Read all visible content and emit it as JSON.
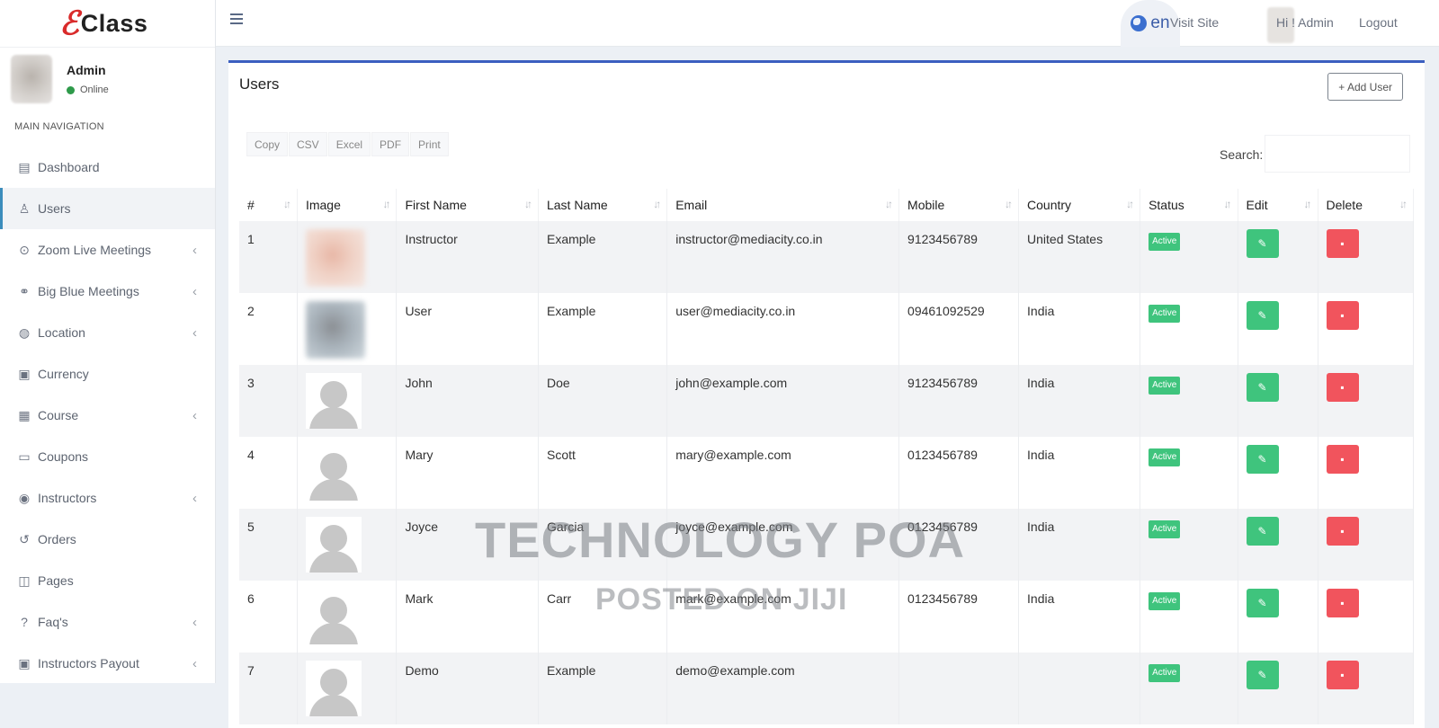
{
  "brand": {
    "mark": "ℰ",
    "name": "Class"
  },
  "user_panel": {
    "name": "Admin",
    "status": "Online"
  },
  "nav": {
    "header": "MAIN NAVIGATION",
    "items": [
      {
        "label": "Dashboard",
        "icon": "id-card-icon",
        "glyph": "▤",
        "chevron": false
      },
      {
        "label": "Users",
        "icon": "user-icon",
        "glyph": "♙",
        "chevron": false
      },
      {
        "label": "Zoom Live Meetings",
        "icon": "play-circle-icon",
        "glyph": "⊙",
        "chevron": true
      },
      {
        "label": "Big Blue Meetings",
        "icon": "handshake-icon",
        "glyph": "⚭",
        "chevron": true
      },
      {
        "label": "Location",
        "icon": "globe-icon",
        "glyph": "◍",
        "chevron": true
      },
      {
        "label": "Currency",
        "icon": "money-icon",
        "glyph": "▣",
        "chevron": false
      },
      {
        "label": "Course",
        "icon": "course-icon",
        "glyph": "▦",
        "chevron": true
      },
      {
        "label": "Coupons",
        "icon": "cc-icon",
        "glyph": "▭",
        "chevron": false
      },
      {
        "label": "Instructors",
        "icon": "user-circle-icon",
        "glyph": "◉",
        "chevron": true
      },
      {
        "label": "Orders",
        "icon": "history-icon",
        "glyph": "↺",
        "chevron": false
      },
      {
        "label": "Pages",
        "icon": "columns-icon",
        "glyph": "◫",
        "chevron": false
      },
      {
        "label": "Faq's",
        "icon": "question-circle-icon",
        "glyph": "?",
        "chevron": true
      },
      {
        "label": "Instructors Payout",
        "icon": "money-icon",
        "glyph": "▣",
        "chevron": true
      }
    ]
  },
  "topbar": {
    "lang": "en",
    "visit_site": "Visit Site",
    "greeting": "Hi ! Admin",
    "logout": "Logout"
  },
  "panel": {
    "title": "Users",
    "add_button": "+ Add User"
  },
  "exports": [
    "Copy",
    "CSV",
    "Excel",
    "PDF",
    "Print"
  ],
  "search": {
    "label": "Search:",
    "placeholder": ""
  },
  "table": {
    "columns": [
      "#",
      "Image",
      "First Name",
      "Last Name",
      "Email",
      "Mobile",
      "Country",
      "Status",
      "Edit",
      "Delete"
    ],
    "rows": [
      {
        "num": "1",
        "image": "photo-warm",
        "first": "Instructor",
        "last": "Example",
        "email": "instructor@mediacity.co.in",
        "mobile": "9123456789",
        "country": "United States",
        "status": "Active"
      },
      {
        "num": "2",
        "image": "photo-cool",
        "first": "User",
        "last": "Example",
        "email": "user@mediacity.co.in",
        "mobile": "09461092529",
        "country": "India",
        "status": "Active"
      },
      {
        "num": "3",
        "image": "placeholder",
        "first": "John",
        "last": "Doe",
        "email": "john@example.com",
        "mobile": "9123456789",
        "country": "India",
        "status": "Active"
      },
      {
        "num": "4",
        "image": "placeholder",
        "first": "Mary",
        "last": "Scott",
        "email": "mary@example.com",
        "mobile": "0123456789",
        "country": "India",
        "status": "Active"
      },
      {
        "num": "5",
        "image": "placeholder",
        "first": "Joyce",
        "last": "Garcia",
        "email": "joyce@example.com",
        "mobile": "0123456789",
        "country": "India",
        "status": "Active"
      },
      {
        "num": "6",
        "image": "placeholder",
        "first": "Mark",
        "last": "Carr",
        "email": "mark@example.com",
        "mobile": "0123456789",
        "country": "India",
        "status": "Active"
      },
      {
        "num": "7",
        "image": "placeholder",
        "first": "Demo",
        "last": "Example",
        "email": "demo@example.com",
        "mobile": "",
        "country": "",
        "status": "Active"
      }
    ]
  },
  "watermark": {
    "line1": "TECHNOLOGY POA",
    "line2": "POSTED ON JIJI"
  },
  "colors": {
    "accent": "#3c5fc0",
    "active_badge": "#3fc47d",
    "delete": "#f1545d",
    "online": "#2e9a4a"
  }
}
